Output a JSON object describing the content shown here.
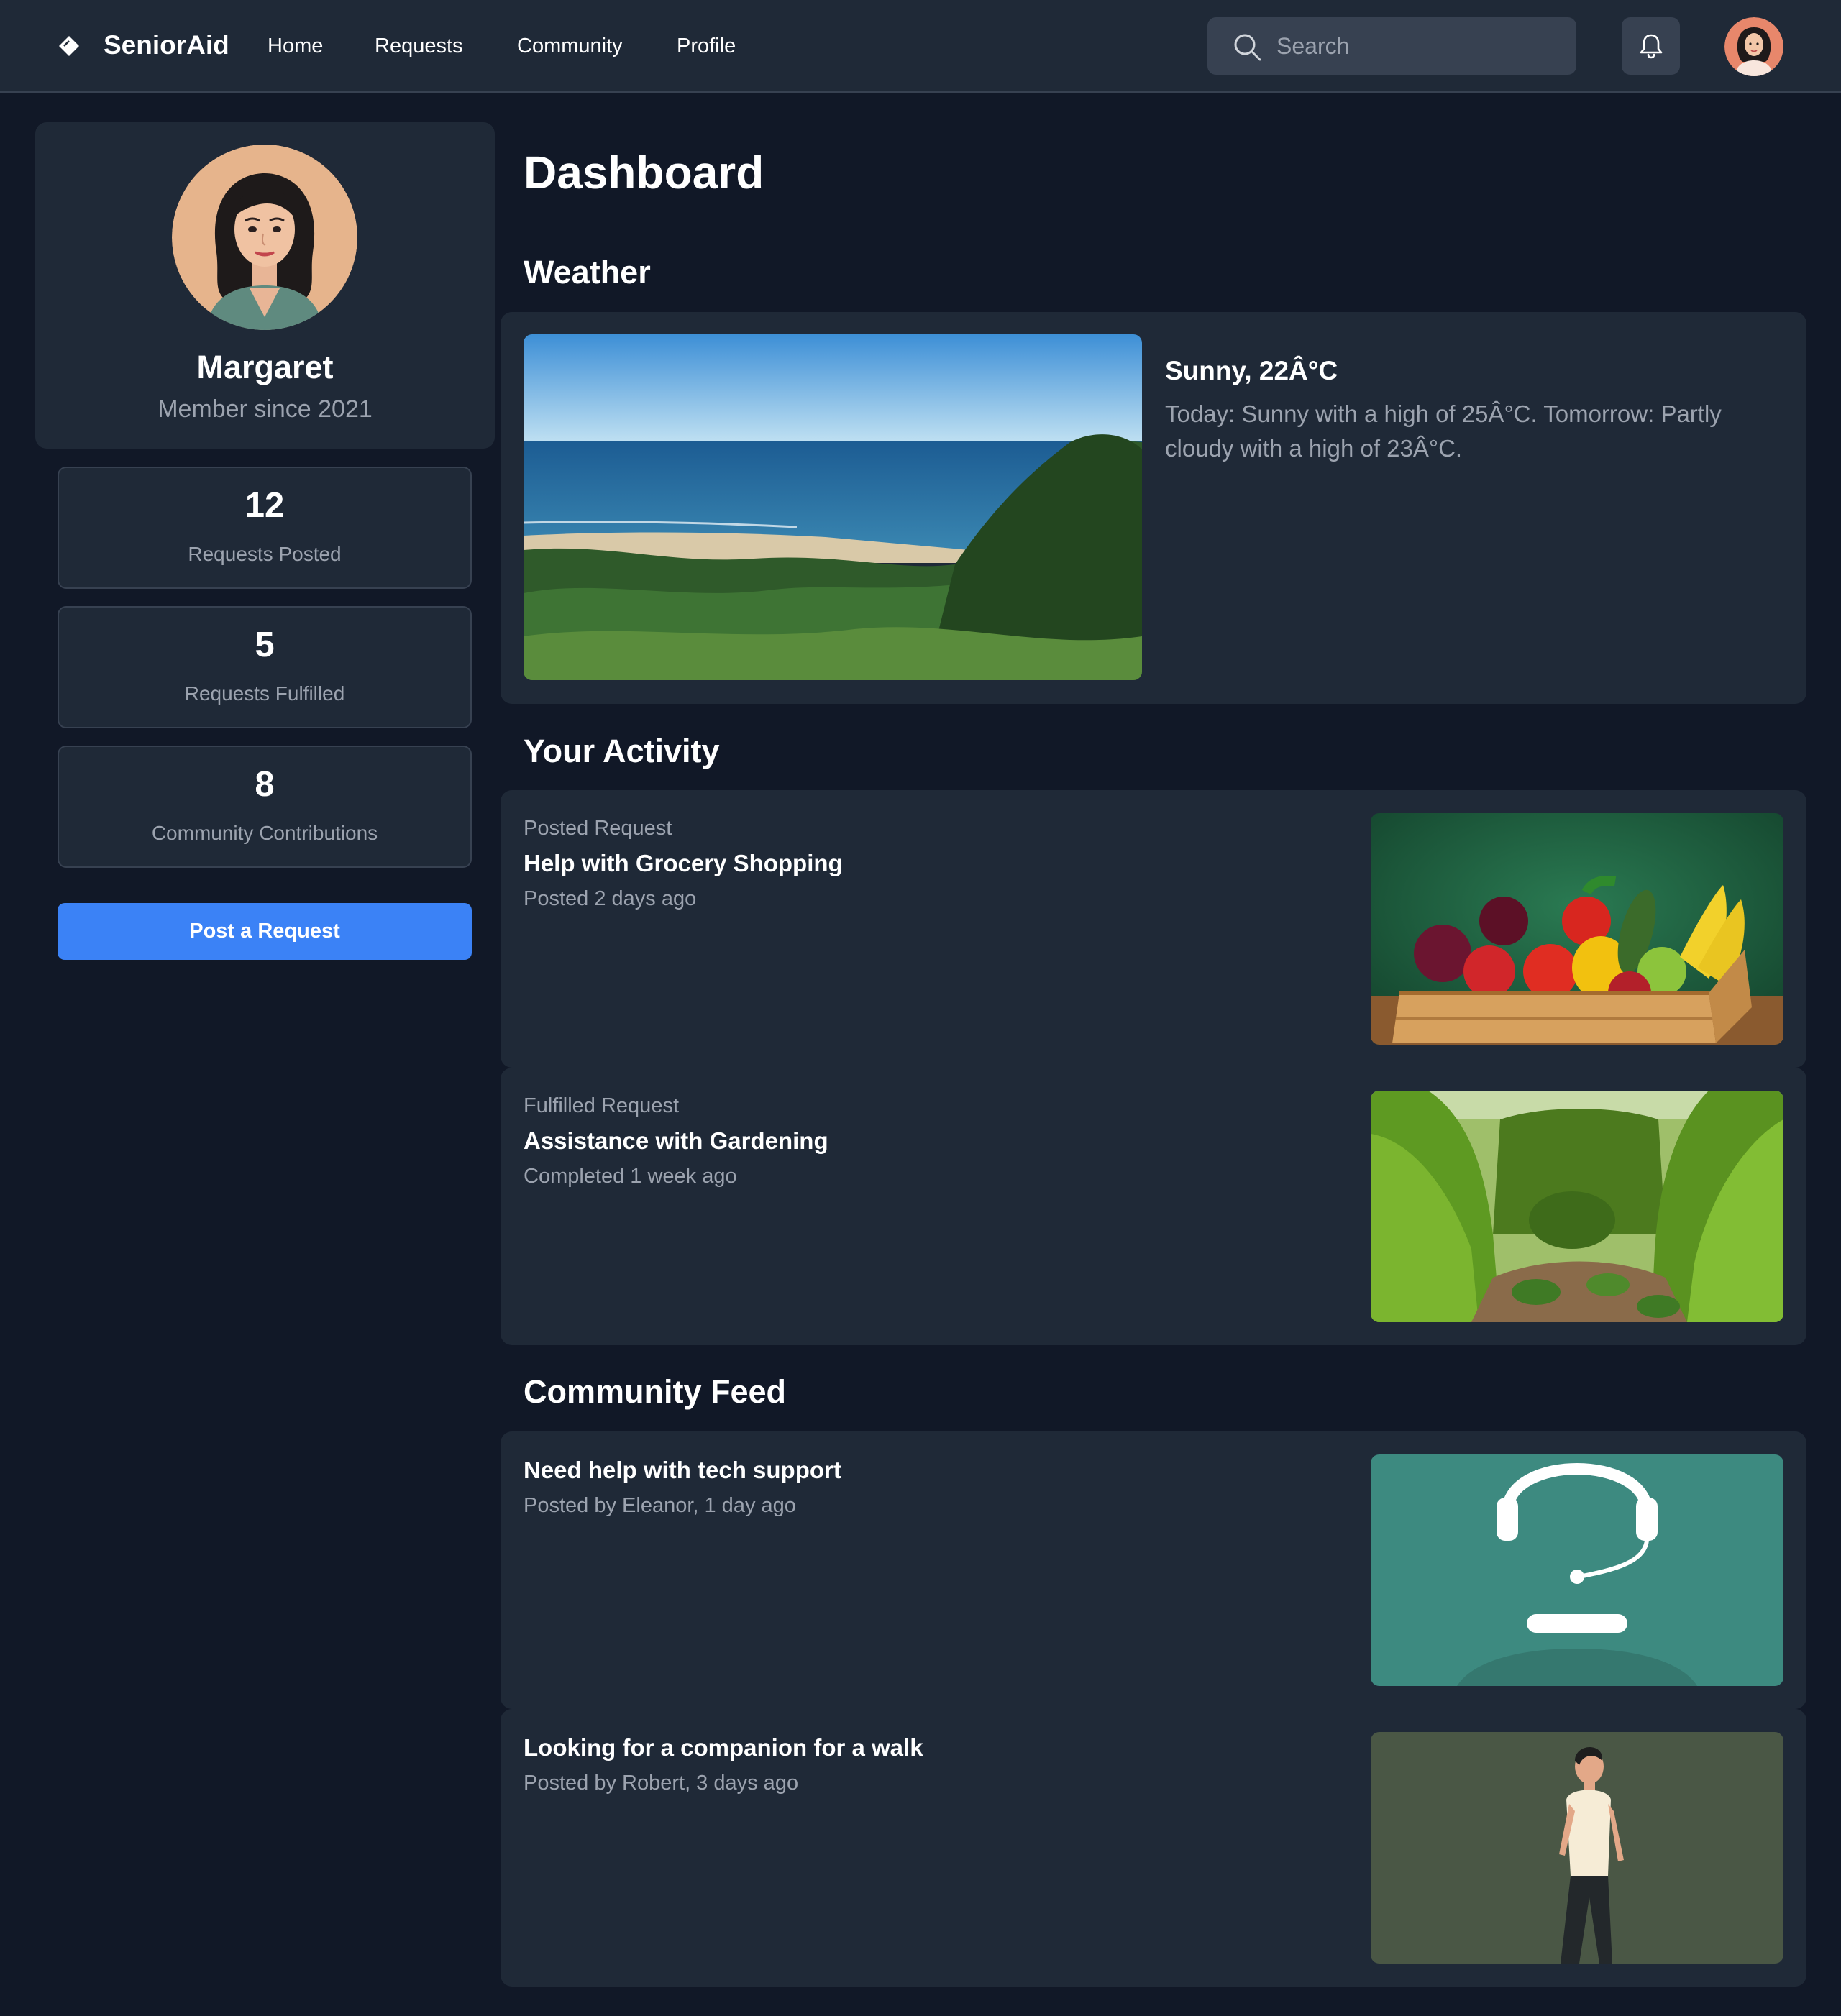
{
  "app": {
    "name": "SeniorAid"
  },
  "nav": {
    "links": [
      "Home",
      "Requests",
      "Community",
      "Profile"
    ],
    "search_placeholder": "Search",
    "icons": {
      "brand": "diamond-logo-icon",
      "search": "search-icon",
      "notifications": "bell-icon"
    }
  },
  "profile": {
    "name": "Margaret",
    "since": "Member since 2021",
    "avatar": "avatar-woman-illustration"
  },
  "stats": [
    {
      "value": "12",
      "label": "Requests Posted"
    },
    {
      "value": "5",
      "label": "Requests Fulfilled"
    },
    {
      "value": "8",
      "label": "Community Contributions"
    }
  ],
  "post_button_label": "Post a Request",
  "page_title": "Dashboard",
  "weather": {
    "heading": "Weather",
    "title": "Sunny, 22Â°C",
    "description": "Today: Sunny with a high of 25Â°C. Tomorrow: Partly cloudy with a high of 23Â°C.",
    "image": "coastal-view-photo"
  },
  "activity": {
    "heading": "Your Activity",
    "items": [
      {
        "kicker": "Posted Request",
        "title": "Help with Grocery Shopping",
        "meta": "Posted 2 days ago",
        "image": "produce-crate-photo"
      },
      {
        "kicker": "Fulfilled Request",
        "title": "Assistance with Gardening",
        "meta": "Completed 1 week ago",
        "image": "garden-photo"
      }
    ]
  },
  "feed": {
    "heading": "Community Feed",
    "items": [
      {
        "title": "Need help with tech support",
        "meta": "Posted by Eleanor, 1 day ago",
        "image": "headset-illustration"
      },
      {
        "title": "Looking for a companion for a walk",
        "meta": "Posted by Robert, 3 days ago",
        "image": "walking-man-illustration"
      }
    ]
  },
  "colors": {
    "background": "#111827",
    "surface": "#1f2937",
    "border": "#374151",
    "muted_text": "#9ca3af",
    "accent": "#3b82f6"
  }
}
